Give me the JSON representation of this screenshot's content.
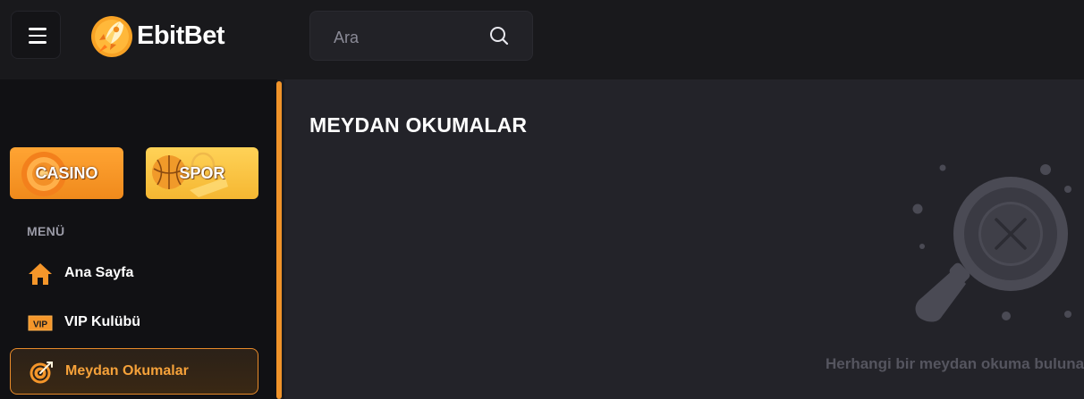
{
  "header": {
    "brand": "EbitBet",
    "search_placeholder": "Ara"
  },
  "sidebar": {
    "categories": [
      {
        "label": "CASINO",
        "color": "#f5962a"
      },
      {
        "label": "SPOR",
        "color": "#f9c444"
      }
    ],
    "menu_heading": "MENÜ",
    "items": [
      {
        "label": "Ana Sayfa",
        "icon": "home-icon"
      },
      {
        "label": "VIP Kulübü",
        "icon": "vip-icon"
      },
      {
        "label": "Meydan Okumalar",
        "icon": "target-icon",
        "active": true
      }
    ]
  },
  "main": {
    "title": "MEYDAN OKUMALAR",
    "empty_message": "Herhangi bir meydan okuma bulunamadı"
  },
  "colors": {
    "accent": "#f0932a",
    "background": "#1b1b1f",
    "panel": "#232329"
  }
}
